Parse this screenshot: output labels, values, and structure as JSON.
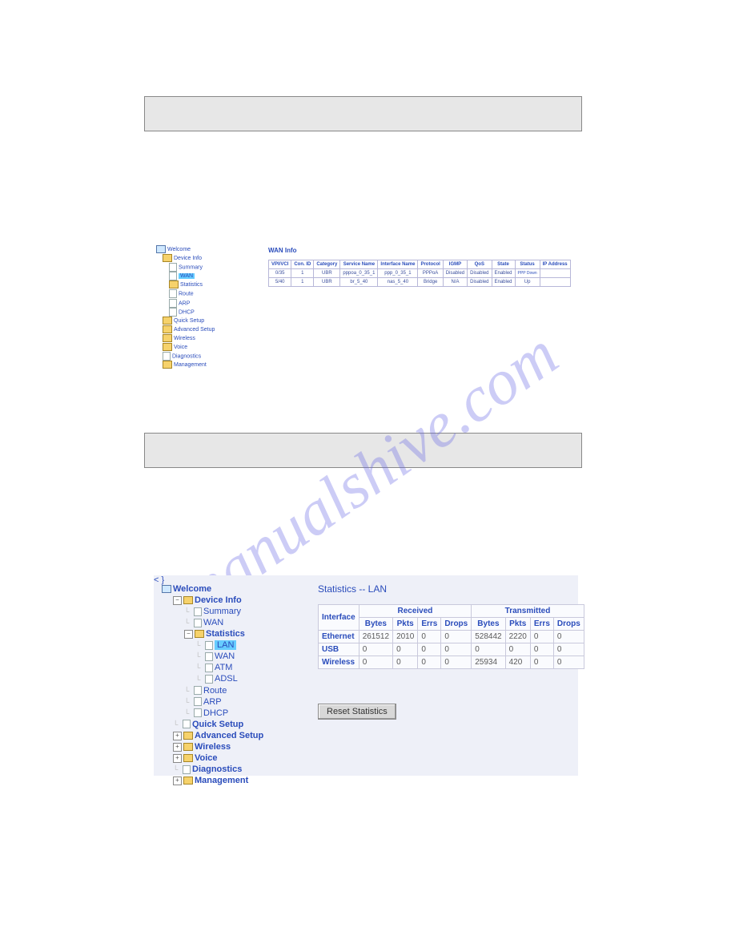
{
  "watermark": "manualshive.com",
  "section1": {
    "title": "WAN Info",
    "tree": {
      "welcome": "Welcome",
      "device_info": "Device Info",
      "summary": "Summary",
      "wan": "WAN",
      "statistics": "Statistics",
      "route": "Route",
      "arp": "ARP",
      "dhcp": "DHCP",
      "quick_setup": "Quick Setup",
      "advanced_setup": "Advanced Setup",
      "wireless": "Wireless",
      "voice": "Voice",
      "diagnostics": "Diagnostics",
      "management": "Management"
    },
    "headers": {
      "vpivci": "VPI/VCI",
      "conid": "Con. ID",
      "category": "Category",
      "service_name": "Service Name",
      "interface_name": "Interface Name",
      "protocol": "Protocol",
      "igmp": "IGMP",
      "qos": "QoS",
      "state": "State",
      "status": "Status",
      "ip_address": "IP Address"
    },
    "rows": [
      {
        "vpivci": "0/35",
        "conid": "1",
        "category": "UBR",
        "service": "pppoa_0_35_1",
        "iface": "ppp_0_35_1",
        "protocol": "PPPoA",
        "igmp": "Disabled",
        "qos": "Disabled",
        "state": "Enabled",
        "status": "PPP Down",
        "ip": ""
      },
      {
        "vpivci": "5/40",
        "conid": "1",
        "category": "UBR",
        "service": "br_5_40",
        "iface": "nas_5_40",
        "protocol": "Bridge",
        "igmp": "N/A",
        "qos": "Disabled",
        "state": "Enabled",
        "status": "Up",
        "ip": ""
      }
    ]
  },
  "section2": {
    "title": "Statistics -- LAN",
    "reset_label": "Reset Statistics",
    "tree": {
      "welcome": "Welcome",
      "device_info": "Device Info",
      "summary": "Summary",
      "wan": "WAN",
      "statistics": "Statistics",
      "lan": "LAN",
      "stat_wan": "WAN",
      "atm": "ATM",
      "adsl": "ADSL",
      "route": "Route",
      "arp": "ARP",
      "dhcp": "DHCP",
      "quick_setup": "Quick Setup",
      "advanced_setup": "Advanced Setup",
      "wireless": "Wireless",
      "voice": "Voice",
      "diagnostics": "Diagnostics",
      "management": "Management"
    },
    "headers": {
      "interface": "Interface",
      "received": "Received",
      "transmitted": "Transmitted",
      "bytes": "Bytes",
      "pkts": "Pkts",
      "errs": "Errs",
      "drops": "Drops"
    },
    "rows": [
      {
        "iface": "Ethernet",
        "r_bytes": "261512",
        "r_pkts": "2010",
        "r_errs": "0",
        "r_drops": "0",
        "t_bytes": "528442",
        "t_pkts": "2220",
        "t_errs": "0",
        "t_drops": "0"
      },
      {
        "iface": "USB",
        "r_bytes": "0",
        "r_pkts": "0",
        "r_errs": "0",
        "r_drops": "0",
        "t_bytes": "0",
        "t_pkts": "0",
        "t_errs": "0",
        "t_drops": "0"
      },
      {
        "iface": "Wireless",
        "r_bytes": "0",
        "r_pkts": "0",
        "r_errs": "0",
        "r_drops": "0",
        "t_bytes": "25934",
        "t_pkts": "420",
        "t_errs": "0",
        "t_drops": "0"
      }
    ]
  }
}
